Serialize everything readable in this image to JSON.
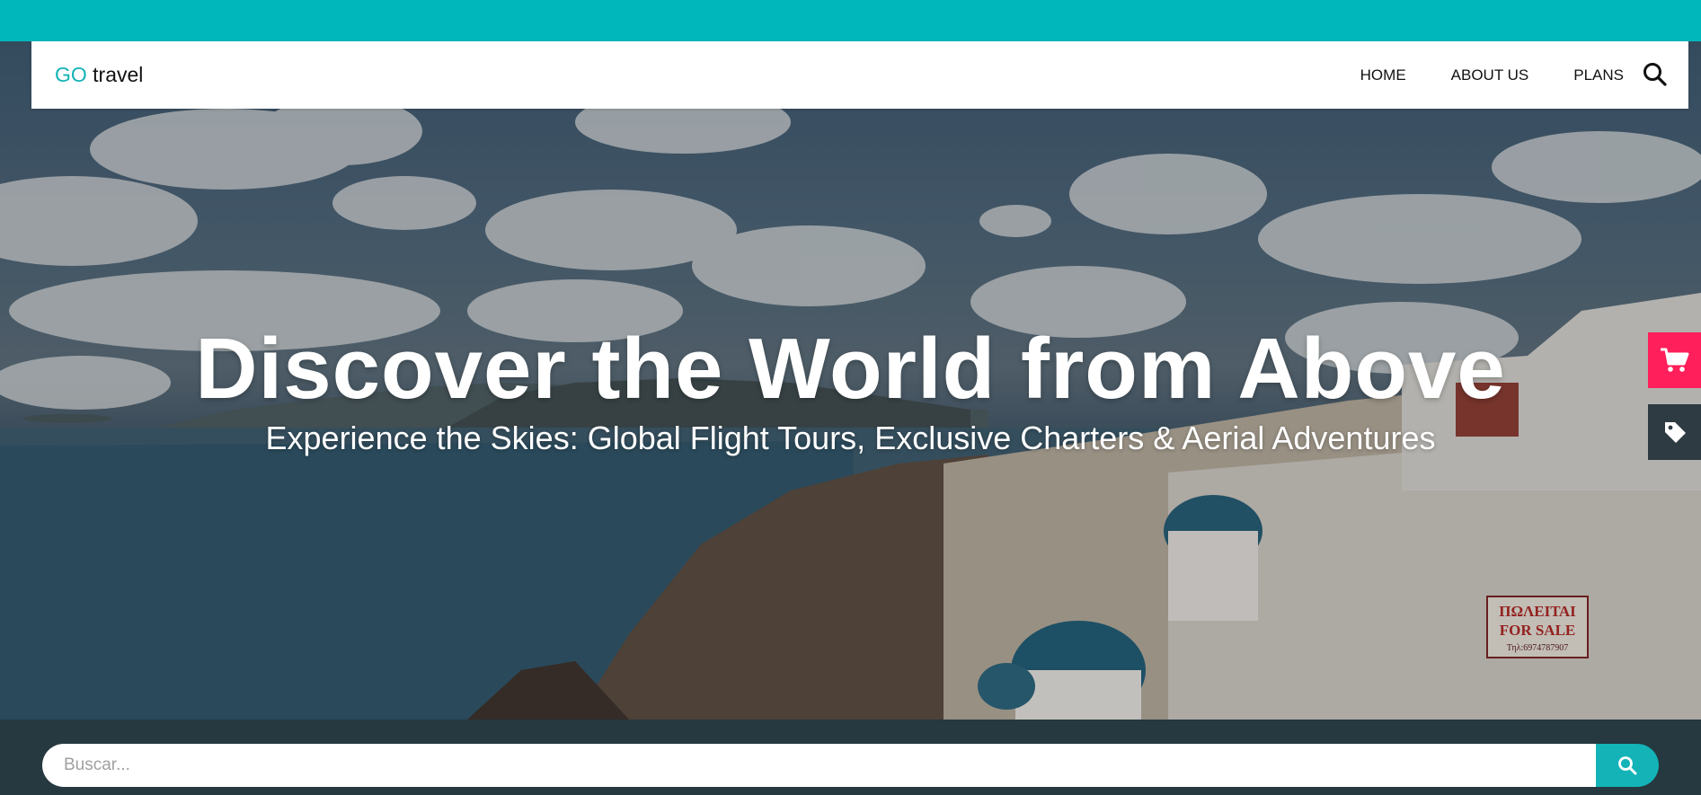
{
  "brand": {
    "accent": "GO",
    "rest": " travel"
  },
  "nav": {
    "items": [
      {
        "label": "HOME"
      },
      {
        "label": "ABOUT US"
      },
      {
        "label": "PLANS"
      }
    ],
    "search_icon": "search-icon"
  },
  "hero": {
    "title": "Discover the World from Above",
    "subtitle": "Experience the Skies: Global Flight Tours, Exclusive Charters & Aerial Adventures",
    "sign_line1": "ΠΩΛΕΙΤΑΙ",
    "sign_line2": "FOR SALE",
    "sign_line3": "Τηλ:6974787907"
  },
  "side_buttons": [
    {
      "icon": "shopping-cart-icon"
    },
    {
      "icon": "tag-icon"
    }
  ],
  "search": {
    "placeholder": "Buscar...",
    "submit_icon": "search-icon"
  },
  "colors": {
    "accent": "#00b8bc",
    "cart": "#ff1f5a",
    "dark": "#263840"
  }
}
